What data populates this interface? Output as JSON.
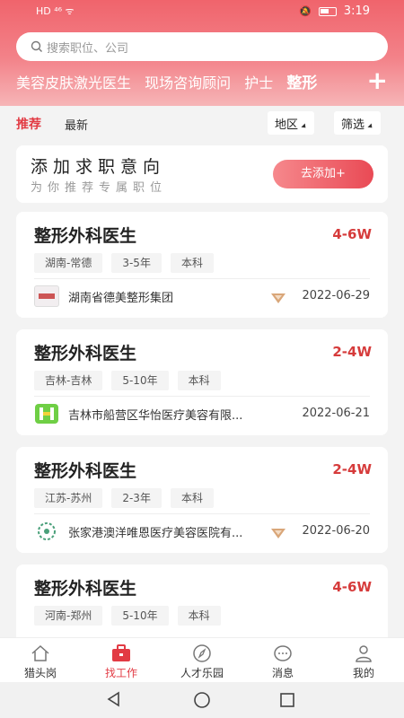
{
  "status": {
    "time": "3:19",
    "left_icons": "HD ⁴⁶ ᯤ"
  },
  "search": {
    "placeholder": "搜索职位、公司"
  },
  "categories": [
    "美容皮肤激光医生",
    "现场咨询顾问",
    "护士",
    "整形"
  ],
  "filter": {
    "tab_recommend": "推荐",
    "tab_latest": "最新",
    "region": "地区",
    "filter": "筛选"
  },
  "intent": {
    "title": "添加求职意向",
    "subtitle": "为你推荐专属职位",
    "button": "去添加+"
  },
  "jobs": [
    {
      "title": "整形外科医生",
      "salary": "4-6W",
      "tags": [
        "湖南-常德",
        "3-5年",
        "本科"
      ],
      "company": "湖南省德美整形集团",
      "date": "2022-06-29",
      "vip": true
    },
    {
      "title": "整形外科医生",
      "salary": "2-4W",
      "tags": [
        "吉林-吉林",
        "5-10年",
        "本科"
      ],
      "company": "吉林市船营区华怡医疗美容有限...",
      "date": "2022-06-21",
      "vip": false
    },
    {
      "title": "整形外科医生",
      "salary": "2-4W",
      "tags": [
        "江苏-苏州",
        "2-3年",
        "本科"
      ],
      "company": "张家港澳洋唯恩医疗美容医院有...",
      "date": "2022-06-20",
      "vip": true
    },
    {
      "title": "整形外科医生",
      "salary": "4-6W",
      "tags": [
        "河南-郑州",
        "5-10年",
        "本科"
      ],
      "company": "",
      "date": "",
      "vip": false
    }
  ],
  "nav": [
    "猎头岗",
    "找工作",
    "人才乐园",
    "消息",
    "我的"
  ],
  "colors": {
    "accent": "#e23b44",
    "header": "#f0646c",
    "salary": "#d63b3b"
  }
}
